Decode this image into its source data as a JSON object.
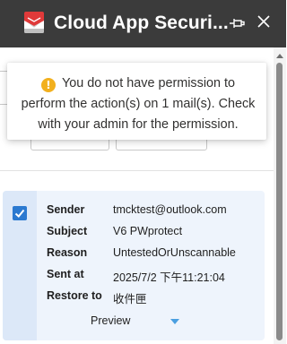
{
  "window": {
    "title": "Cloud App Securi...",
    "accent_color": "#3b3b3b",
    "icon": "mail-security-icon"
  },
  "toast": {
    "icon": "warning-icon",
    "icon_glyph": "!",
    "message": "You do not have permission to perform the action(s) on 1 mail(s). Check with your admin for the permission."
  },
  "mail": {
    "selected": true,
    "fields": [
      {
        "label": "Sender",
        "value": "tmcktest@outlook.com"
      },
      {
        "label": "Subject",
        "value": "V6 PWprotect"
      },
      {
        "label": "Reason",
        "value": "UntestedOrUnscannable"
      },
      {
        "label": "Sent at",
        "value": "2025/7/2 下午11:21:04"
      },
      {
        "label": "Restore to",
        "value": "收件匣"
      }
    ],
    "preview_label": "Preview"
  }
}
